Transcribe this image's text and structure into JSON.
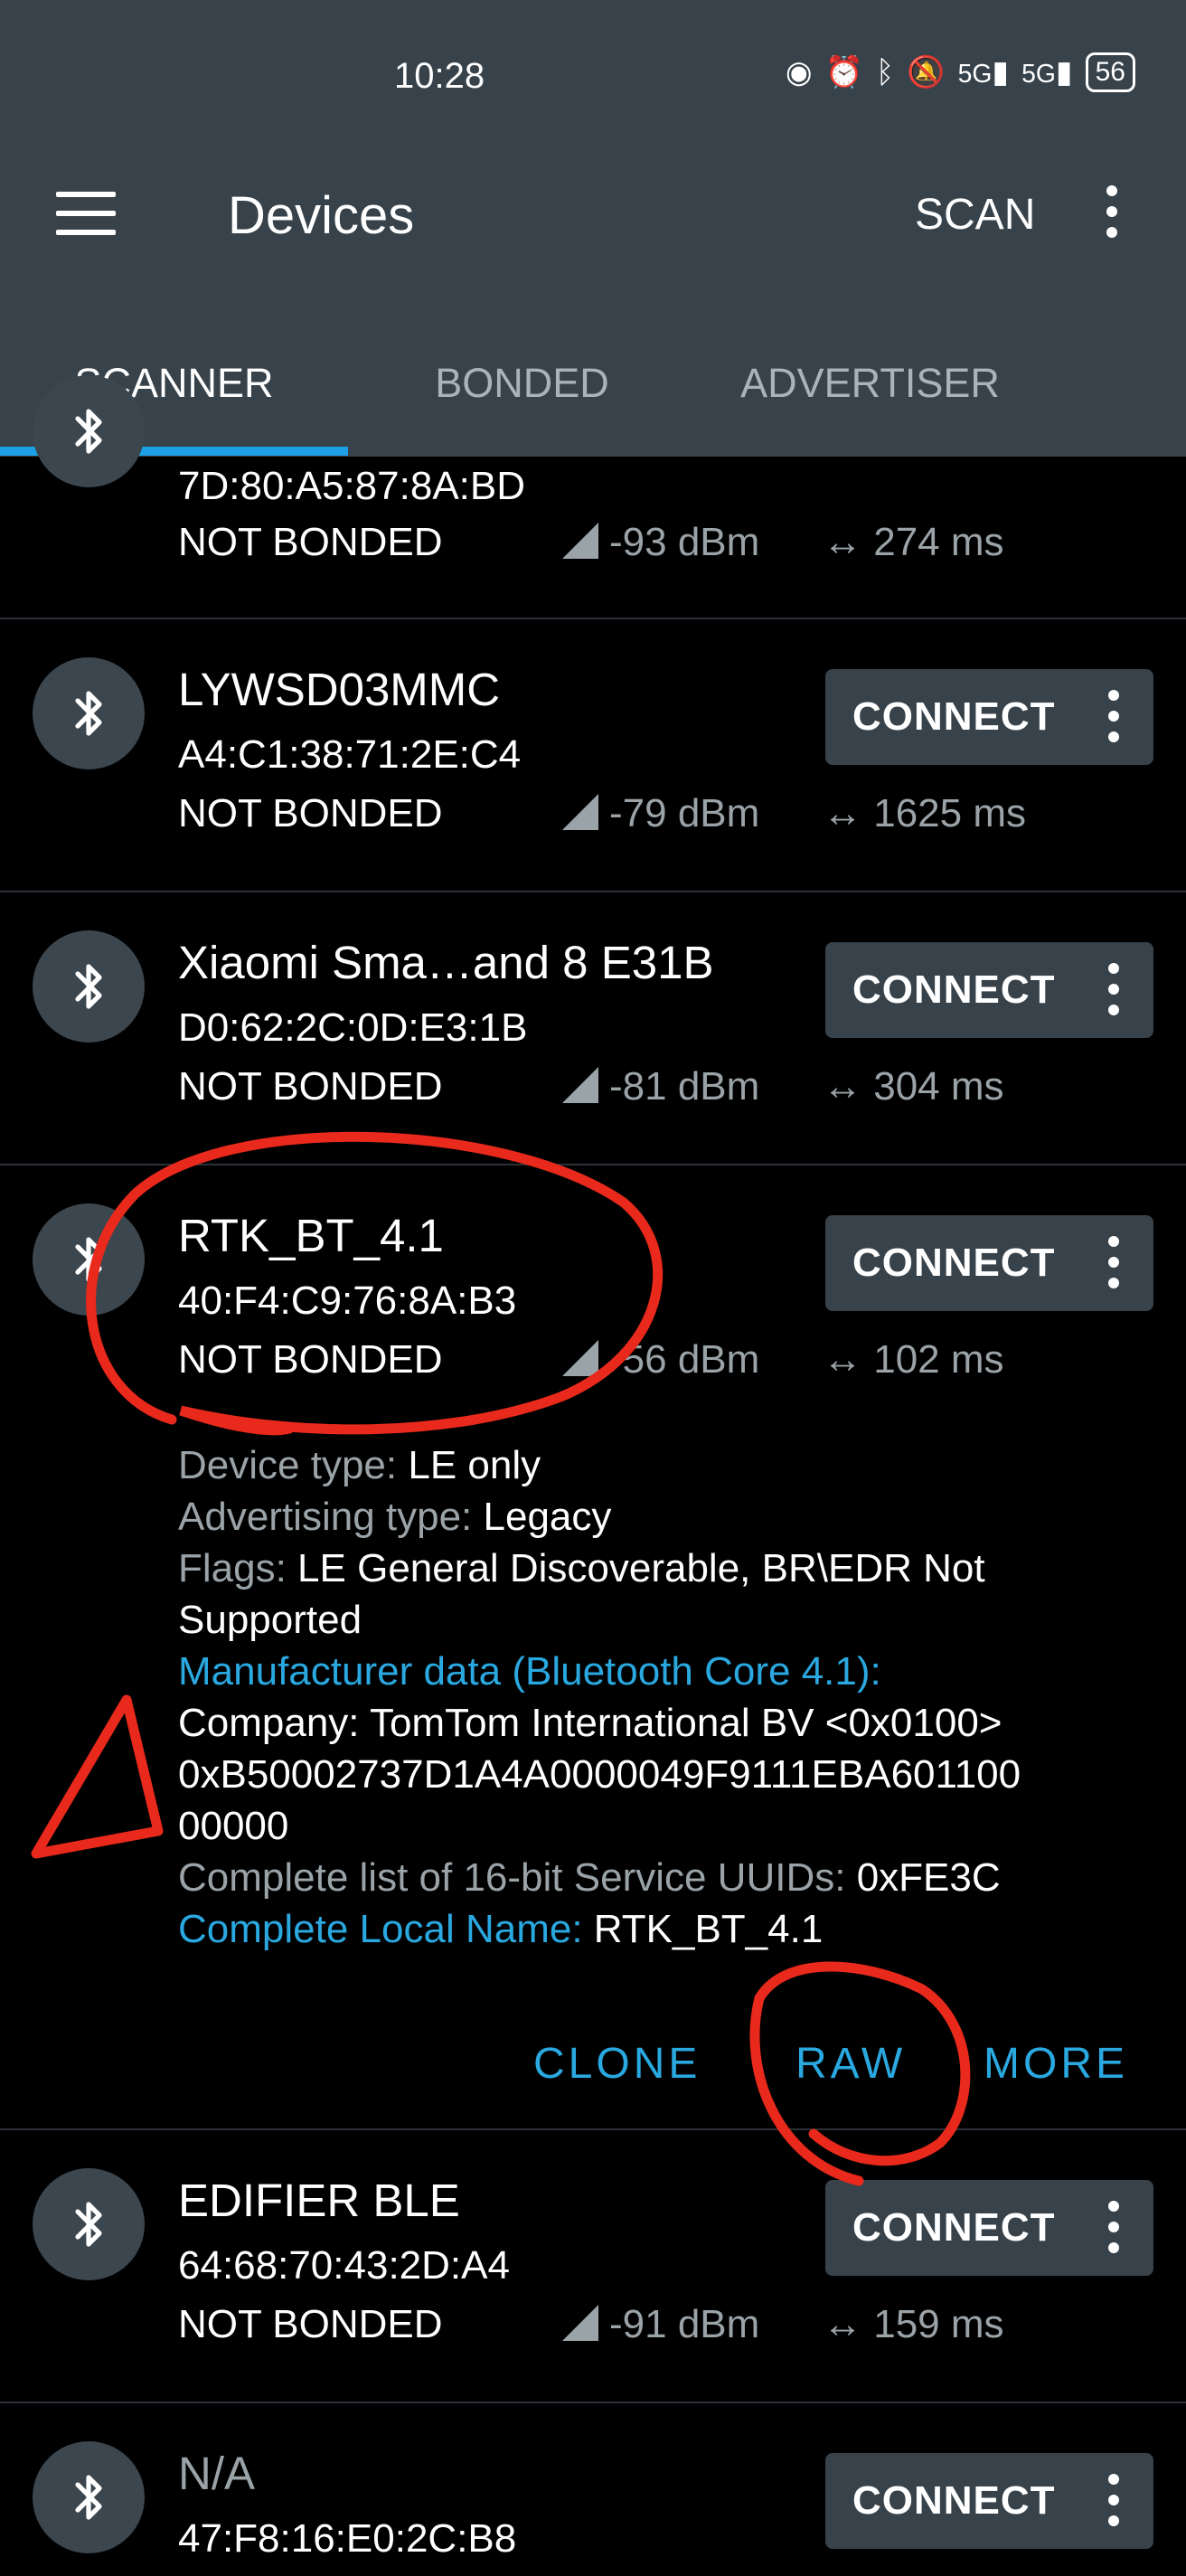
{
  "status_bar": {
    "time": "10:28",
    "battery": "56",
    "net1": "5G",
    "net2": "5G"
  },
  "app_bar": {
    "title": "Devices",
    "scan_label": "SCAN"
  },
  "tabs": [
    {
      "label": "SCANNER"
    },
    {
      "label": "BONDED"
    },
    {
      "label": "ADVERTISER"
    }
  ],
  "connect_label": "CONNECT",
  "devices": [
    {
      "name": "",
      "address": "7D:80:A5:87:8A:BD",
      "bond": "NOT BONDED",
      "rssi": "-93 dBm",
      "interval": "274 ms"
    },
    {
      "name": "LYWSD03MMC",
      "address": "A4:C1:38:71:2E:C4",
      "bond": "NOT BONDED",
      "rssi": "-79 dBm",
      "interval": "1625 ms"
    },
    {
      "name": "Xiaomi Sma…and 8 E31B",
      "address": "D0:62:2C:0D:E3:1B",
      "bond": "NOT BONDED",
      "rssi": "-81 dBm",
      "interval": "304 ms"
    },
    {
      "name": "RTK_BT_4.1",
      "address": "40:F4:C9:76:8A:B3",
      "bond": "NOT BONDED",
      "rssi": "-56 dBm",
      "interval": "102 ms"
    },
    {
      "name": "EDIFIER BLE",
      "address": "64:68:70:43:2D:A4",
      "bond": "NOT BONDED",
      "rssi": "-91 dBm",
      "interval": "159 ms"
    },
    {
      "name": "N/A",
      "address": "47:F8:16:E0:2C:B8"
    }
  ],
  "expanded": {
    "device_type_label": "Device type: ",
    "device_type": "LE only",
    "adv_type_label": "Advertising type: ",
    "adv_type": "Legacy",
    "flags_label": "Flags: ",
    "flags": "LE General Discoverable, BR\\EDR Not Supported",
    "manufacturer_label": "Manufacturer data (Bluetooth Core 4.1):",
    "company_line": "Company: TomTom International BV <0x0100>",
    "data_line1": "0xB50002737D1A4A0000049F9111EBA601100",
    "data_line2": "00000",
    "uuids_label": "Complete list of 16-bit Service UUIDs: ",
    "uuids": "0xFE3C",
    "local_name_label": "Complete Local Name: ",
    "local_name": "RTK_BT_4.1",
    "actions": {
      "clone": "CLONE",
      "raw": "RAW",
      "more": "MORE"
    }
  },
  "annotation_color": "#e8291c"
}
